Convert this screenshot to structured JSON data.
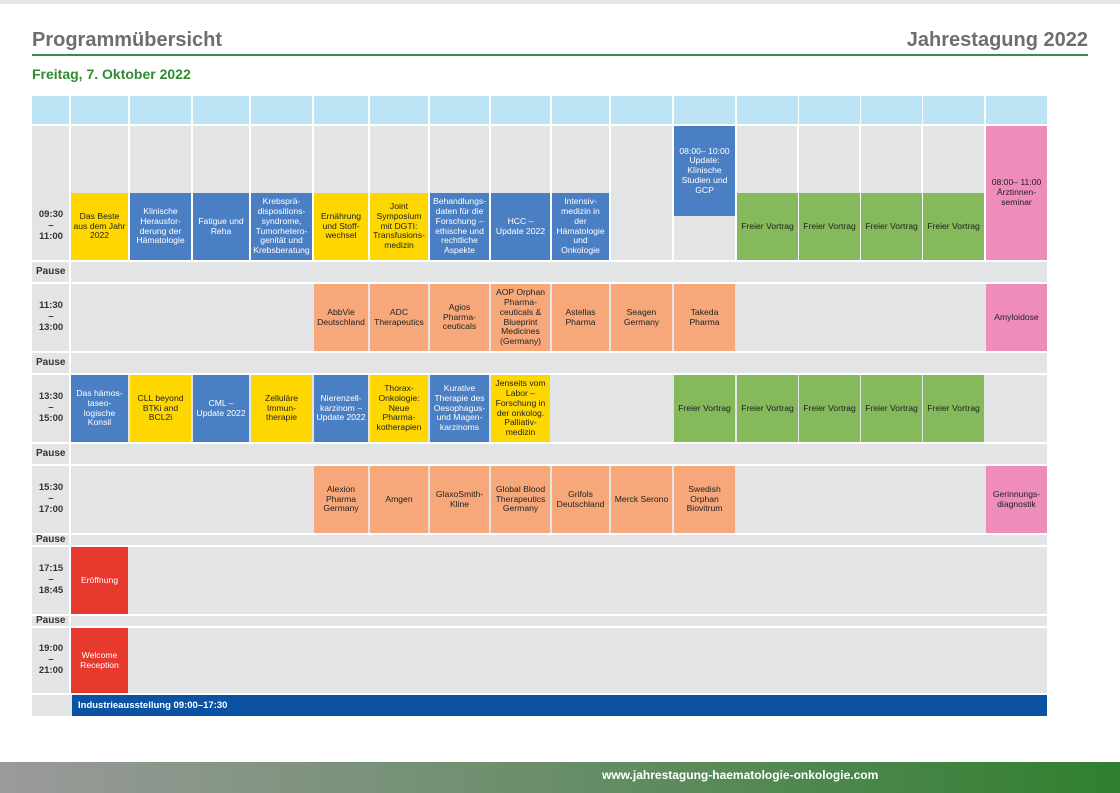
{
  "header": {
    "title": "Programmübersicht",
    "event": "Jahrestagung 2022",
    "date": "Freitag, 7. Oktober 2022"
  },
  "pause_label": "Pause",
  "times": {
    "s1": [
      "09:30",
      "–",
      "11:00"
    ],
    "s2": [
      "11:30",
      "–",
      "13:00"
    ],
    "s3": [
      "13:30",
      "–",
      "15:00"
    ],
    "s4": [
      "15:30",
      "–",
      "17:00"
    ],
    "s5": [
      "17:15",
      "–",
      "18:45"
    ],
    "s6": [
      "19:00",
      "–",
      "21:00"
    ]
  },
  "sessions": {
    "s1": {
      "c1": "Das Beste aus dem Jahr 2022",
      "c2": "Klinische Herausfor-derung der Hämatologie",
      "c3": "Fatigue und Reha",
      "c4": "Krebsprä-dispositions-syndrome, Tumorhetero-genität und Krebsberatung",
      "c5": "Ernährung und Stoff-wechsel",
      "c6": "Joint Symposium mit DGTI: Transfusions-medizin",
      "c7": "Behandlungs-daten für die Forschung – ethische und rechtliche Aspekte",
      "c8": "HCC – Update 2022",
      "c9": "Intensiv-medizin in der Hämatologie und Onkologie",
      "c11": "08:00– 10:00 Update: Klinische Studien und GCP",
      "c12": "Freier Vortrag",
      "c13": "Freier Vortrag",
      "c14": "Freier Vortrag",
      "c15": "Freier Vortrag",
      "c16": "08:00– 11:00 Ärztinnen-seminar"
    },
    "s2": {
      "c5": "AbbVie Deutschland",
      "c6": "ADC Therapeutics",
      "c7": "Agios Pharma-ceuticals",
      "c8": "AOP Orphan Pharma-ceuticals & Blueprint Medicines (Germany)",
      "c9": "Astellas Pharma",
      "c10": "Seagen Germany",
      "c11": "Takeda Pharma",
      "c16": "Amyloidose"
    },
    "s3": {
      "c1": "Das hämos-taseo-logische Konsil",
      "c2": "CLL beyond BTKi and BCL2i",
      "c3": "CML – Update 2022",
      "c4": "Zelluläre Immun-therapie",
      "c5": "Nierenzell-karzinom – Update 2022",
      "c6": "Thorax-Onkologie: Neue Pharma-kotherapien",
      "c7": "Kurative Therapie des Oesophagus- und Magen-karzinoms",
      "c8": "Jenseits vom Labor – Forschung in der onkolog. Palliativ-medizin",
      "c11": "Freier Vortrag",
      "c12": "Freier Vortrag",
      "c13": "Freier Vortrag",
      "c14": "Freier Vortrag",
      "c15": "Freier Vortrag"
    },
    "s4": {
      "c5": "Alexion Pharma Germany",
      "c6": "Amgen",
      "c7": "GlaxoSmith-Kline",
      "c8": "Global Blood Therapeutics Germany",
      "c9": "Grifols Deutschland",
      "c10": "Merck Serono",
      "c11": "Swedish Orphan Biovitrum",
      "c16": "Gerinnungs-diagnostik"
    },
    "s5": {
      "c1": "Eröffnung"
    },
    "s6": {
      "c1": "Welcome Reception"
    }
  },
  "industry_bar": "Industrieausstellung 09:00–17:30",
  "footer_url": "www.jahrestagung-haematologie-onkologie.com",
  "colors": {
    "blue": "#4b7fc3",
    "yellow": "#ffd700",
    "orange": "#f6a87a",
    "green": "#85b95b",
    "pink": "#ee8cbc",
    "red": "#e8392f",
    "header_cyan": "#bde4f5",
    "band_grey": "#e3e4e5",
    "title_green": "#2f8b2f",
    "industry_blue": "#0b52a3"
  }
}
